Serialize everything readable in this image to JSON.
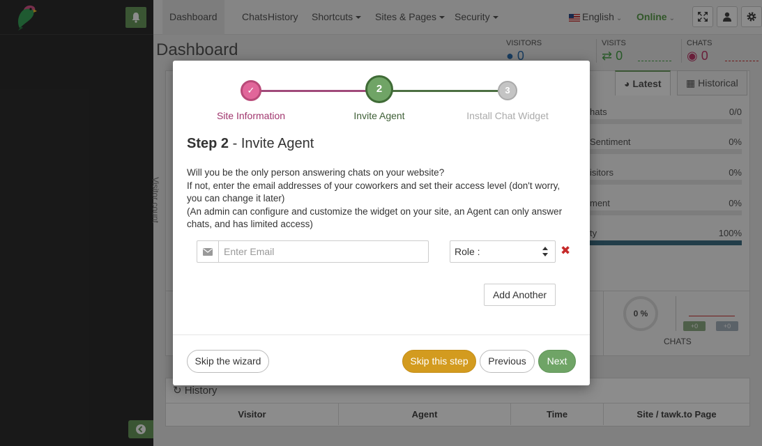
{
  "nav": {
    "items": [
      {
        "label": "Dashboard",
        "active": true,
        "dropdown": false
      },
      {
        "label": "Chats",
        "active": false,
        "dropdown": false
      },
      {
        "label": "History",
        "active": false,
        "dropdown": false
      },
      {
        "label": "Shortcuts",
        "active": false,
        "dropdown": true
      },
      {
        "label": "Sites & Pages",
        "active": false,
        "dropdown": true
      },
      {
        "label": "Security",
        "active": false,
        "dropdown": true
      }
    ],
    "language": "English",
    "status": "Online",
    "status_color": "#5a9e4b"
  },
  "page": {
    "title": "Dashboard",
    "stats": {
      "visitors_label": "VISITORS",
      "visitors_value": "0",
      "visits_label": "VISITS",
      "visits_value": "0",
      "chats_label": "CHATS",
      "chats_value": "0"
    },
    "tabs": {
      "latest": "Latest",
      "historical": "Historical"
    },
    "metrics": [
      {
        "label": "hats",
        "value": "0/0",
        "fill": 0
      },
      {
        "label": "Sentiment",
        "value": "0%",
        "fill": 0
      },
      {
        "label": "isitors",
        "value": "0%",
        "fill": 0
      },
      {
        "label": "ment",
        "value": "0%",
        "fill": 0
      },
      {
        "label": "ty",
        "value": "100%",
        "fill": 1
      }
    ],
    "visitor_count_label": "Visitor count",
    "chats_gauge": {
      "value": "0 %",
      "label": "CHATS",
      "badge_up": "+0",
      "badge_down": "+0"
    },
    "history": {
      "title": "History",
      "columns": [
        "Visitor",
        "Agent",
        "Time",
        "Site / tawk.to Page"
      ]
    }
  },
  "wizard": {
    "steps": [
      {
        "number": "✓",
        "label": "Site Information",
        "state": "done",
        "color": "#d9548a"
      },
      {
        "number": "2",
        "label": "Invite Agent",
        "state": "current",
        "color": "#5c8e4f"
      },
      {
        "number": "3",
        "label": "Install Chat Widget",
        "state": "pending",
        "color": "#bbbbbb"
      }
    ],
    "heading_step": "Step 2",
    "heading_sep": " - ",
    "heading_title": "Invite Agent",
    "text": [
      "Will you be the only person answering chats on your website?",
      "If not, enter the email addresses of your coworkers and set their access level (don't worry, you can change it later)",
      "(An admin can configure and customize the widget on your site, an Agent can only answer chats, and has limited access)"
    ],
    "email_placeholder": "Enter Email",
    "email_value": "",
    "role_selected": "Role :",
    "add_another": "Add Another",
    "buttons": {
      "skip_wizard": "Skip the wizard",
      "skip_step": "Skip this step",
      "previous": "Previous",
      "next": "Next"
    }
  }
}
